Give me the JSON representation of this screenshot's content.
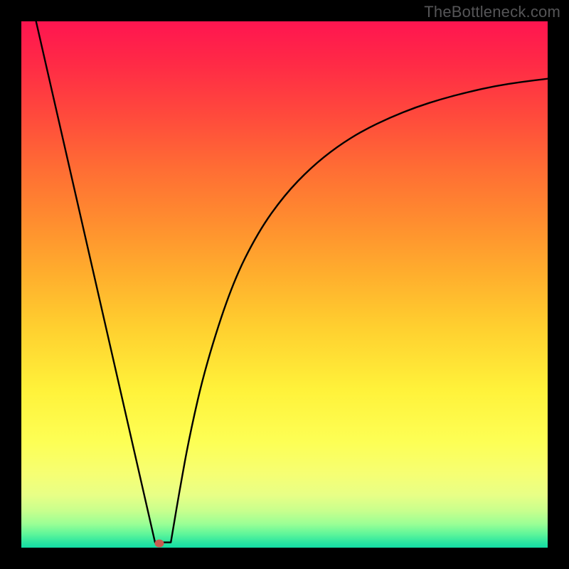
{
  "watermark": "TheBottleneck.com",
  "marker": {
    "x_frac": 0.262,
    "y_frac": 0.992
  },
  "chart_data": {
    "type": "line",
    "title": "",
    "xlabel": "",
    "ylabel": "",
    "xlim": [
      0,
      1
    ],
    "ylim": [
      0,
      1
    ],
    "series": [
      {
        "name": "left-branch",
        "x": [
          0.028,
          0.254
        ],
        "y": [
          1.0,
          0.01
        ]
      },
      {
        "name": "valley-floor",
        "x": [
          0.254,
          0.284
        ],
        "y": [
          0.01,
          0.01
        ]
      },
      {
        "name": "right-branch",
        "x": [
          0.284,
          0.3,
          0.32,
          0.35,
          0.4,
          0.45,
          0.5,
          0.55,
          0.6,
          0.65,
          0.7,
          0.75,
          0.8,
          0.85,
          0.9,
          0.95,
          1.0
        ],
        "y": [
          0.01,
          0.105,
          0.215,
          0.345,
          0.5,
          0.6,
          0.67,
          0.722,
          0.762,
          0.793,
          0.817,
          0.837,
          0.853,
          0.866,
          0.877,
          0.885,
          0.891
        ]
      }
    ],
    "marker_point": {
      "x": 0.262,
      "y": 0.008
    },
    "background_gradient": {
      "top_color": "#ff1550",
      "mid_color": "#ffd233",
      "bottom_color": "#13dca4"
    }
  }
}
